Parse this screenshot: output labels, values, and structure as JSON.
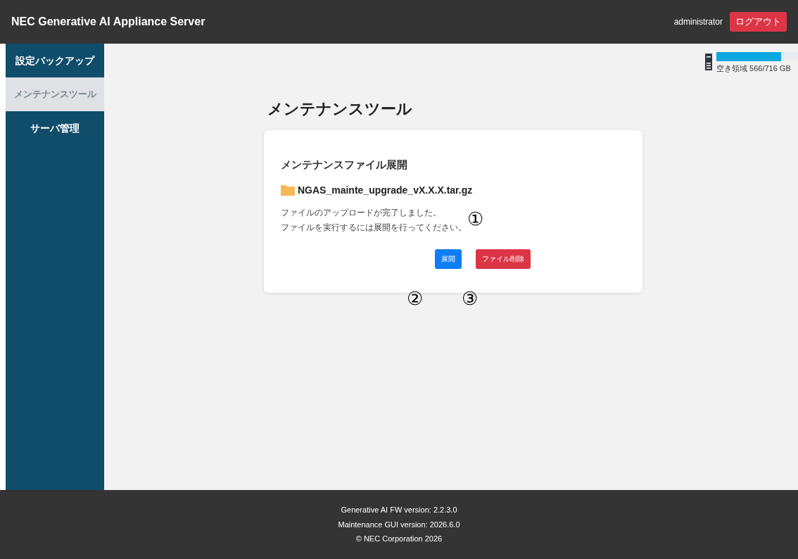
{
  "header": {
    "title": "NEC Generative AI Appliance Server",
    "user": "administrator",
    "logout": "ログアウト"
  },
  "sidebar": {
    "items": [
      {
        "label": "設定バックアップ",
        "selected": false
      },
      {
        "label": "メンテナンスツール",
        "selected": true
      },
      {
        "label": "サーバ管理",
        "selected": false
      }
    ]
  },
  "storage": {
    "level": 0.79,
    "label": "空き領域 566/716 GB"
  },
  "page_title": "メンテナンスツール",
  "card": {
    "title": "メンテナンスファイル展開",
    "file_name": "NGAS_mainte_upgrade_vX.X.X.tar.gz",
    "messages": [
      "ファイルのアップロードが完了しました。",
      "ファイルを実行するには展開を行ってください。"
    ],
    "buttons": [
      {
        "label": "展開",
        "kind": "primary"
      },
      {
        "label": "ファイル削除",
        "kind": "danger"
      }
    ]
  },
  "callouts": [
    "①",
    "②",
    "③"
  ],
  "footer": [
    "Generative AI FW version: 2.2.3.0",
    "Maintenance GUI version: 2026.6.0",
    "© NEC Corporation 2026"
  ]
}
